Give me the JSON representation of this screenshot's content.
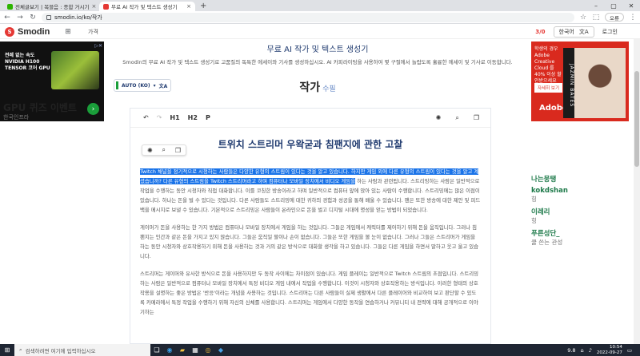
{
  "browser": {
    "tabs": [
      {
        "title": "전체글보기 | 복블음 : 종합 거시기",
        "active": false,
        "fav_color": "#2db400"
      },
      {
        "title": "무료 AI 작가 및 텍스트 생성기",
        "active": true,
        "fav_color": "#e53935"
      }
    ],
    "new_tab": "+",
    "url": "smodin.io/ko/작가",
    "profile": "오류"
  },
  "site": {
    "logo": "Smodin",
    "logo_mark": "S",
    "nav_link": "가격",
    "credits": "3/0",
    "lang_btn": "한국어",
    "login": "로그인"
  },
  "ads": {
    "left_text": "전례 없는 속도 NVIDIA H100 TENSOR 코어 GPU",
    "left_cta_title": "GPU 퀴즈 이벤트",
    "left_cta_sub": "한국인프라",
    "right_text": "학생의 경우 Adobe Creative Cloud 를 40% 이상 할인받으세요",
    "right_btn": "자세히 보기",
    "right_brand": "Adobe",
    "right_card": "JAZMIN BATES"
  },
  "main": {
    "title": "무료 AI 작가 및 텍스트 생성기",
    "desc": "Smodin의 무료 AI 작가 및 텍스트 생성기로 고품질의 독특한 에세이와 기사를 생성하십시오. AI 카피라이팅을 사용하여 몇 구절에서 놀랍도록 훌륭한 에세이 및 기사로 이동합니다.",
    "lang_select": "AUTO (KO)",
    "writer_title": "작가",
    "writer_sub": "수필"
  },
  "editor": {
    "toolbar": {
      "h1": "H1",
      "h2": "H2",
      "p": "P"
    },
    "doc_title": "트위치 스트리머 우왁굳과 침팬지에 관한 고찰",
    "paragraphs": [
      {
        "selected": "Twitch 채널을 정기적으로 시청하는 사람들은 다양한 유형의 스트림이 있다는 것을 알고 있습니다. 하지만 게임 외에 다른 유형의 스트림이 있다는 것을 알고 계셨습니까? 다른 유형의 스트림을 Twitch 스트리머라고 하며 컴퓨터나 모바일 장치에서 비디오 게임을",
        "rest": " 하는 사람과 관련됩니다. 스트리밍하는 사람은 일반적으로 작업을 수행하는 동안 시청자와 직접 대화합니다. 이를 코칭한 방송이라고 하며 일반적으로 컴퓨터 앞에 앉아 있는 사람이 수행합니다. 스트리밍에는 많은 이점이 있습니다. 하나는 돈을 벌 수 있다는 것입니다. 다른 사람들도 스트리밍에 대한 귀하의 경험과 성공을 통해 배울 수 있습니다. 팬은 또한 방송에 대한 제안 및 피드백을 메시지로 보낼 수 있습니다. 기본적으로 스트리밍은 사람들이 온라인으로 돈을 벌고 디지털 시대에 명성을 얻는 방법이 되었습니다."
      },
      {
        "selected": "",
        "rest": "게이머가 돈을 사용하는 한 가지 방법은 컴퓨터나 모바일 장치에서 게임을 하는 것입니다. 그들은 게임에서 캐릭터를 제어하기 위해 돈을 움직입니다. 그러나 침팬지는 인간과 같은 돈을 가지고 있지 않습니다. 그들은 움직일 팔이나 손이 없습니다. 그들은 또한 게임을 볼 눈이 없습니다. 그러나 그들은 스트리머가 게임을 하는 동안 시청자와 상호작용하기 위해 돈을 사용하는 것과 거의 같은 방식으로 대화할 생각을 하고 있습니다. 그들은 다른 게임을 하면서 말하고 웃고 울고 있습니다."
      },
      {
        "selected": "",
        "rest": "스트리머는 게이머와 유사한 방식으로 돈을 사용하지만 두 동작 사이에는 차이점이 있습니다. 게임 플레이는 일반적으로 Twitch 스트림의 초점입니다. 스트리밍하는 사람은 일반적으로 컴퓨터나 모바일 장치에서 특정 비디오 게임 내에서 작업을 수행합니다. 이것이 시청자와 상호작용하는 방식입니다. 이러한 형태의 상호작용을 설명하는 좋은 방법은 '반응'이라는 개념을 사용하는 것입니다. 스트리머는 다른 사람들이 실제 생활에서 다른 플레이어와 비교하여 보고 판단할 수 있도록 카메라에서 특정 작업을 수행하기 위해 자신의 신체를 사용합니다. 스트리머는 게임에서 다양한 동작을 연습하거나 커뮤니티 내 전략에 대해 공개적으로 이야기하는"
      }
    ]
  },
  "chat": [
    {
      "name": "나는뭉탱",
      "msg": ""
    },
    {
      "name": "kokdshan",
      "msg": "힝"
    },
    {
      "name": "이레리",
      "msg": "힝"
    },
    {
      "name": "푸른성단_",
      "msg": "쿨 쓴는 관성"
    }
  ],
  "taskbar": {
    "search_placeholder": "검색하려면 여기에 입력하십시오",
    "time": "10:54",
    "date": "2022-09-27",
    "tray_label": "9.8"
  },
  "icons": {
    "undo": "undo-icon",
    "redo": "redo-icon",
    "search": "search-icon",
    "copy": "copy-icon",
    "ai": "ai-icon"
  }
}
